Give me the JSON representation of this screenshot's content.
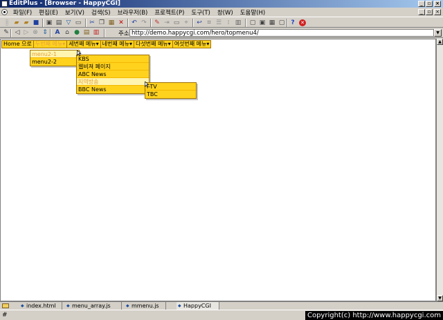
{
  "window": {
    "title": "EditPlus - [Browser - HappyCGI]"
  },
  "menubar": {
    "items": [
      "파일(F)",
      "편집(E)",
      "보기(V)",
      "검색(S)",
      "브라우저(B)",
      "프로젝트(P)",
      "도구(T)",
      "창(W)",
      "도움말(H)"
    ]
  },
  "toolbar": {
    "icons": [
      "new-file-icon",
      "open-icon",
      "save-all-icon",
      "save-icon",
      "print-preview-icon",
      "print-icon",
      "spellcheck-icon",
      "copy-file-icon",
      "cut-icon",
      "copy-icon",
      "paste-icon",
      "delete-icon",
      "undo-icon",
      "redo-icon",
      "find-icon",
      "find-next-icon",
      "replace-icon",
      "goto-icon",
      "word-wrap-icon",
      "ruler-icon",
      "line-number-icon",
      "column-icon",
      "split-icon",
      "full-screen-icon",
      "view-icon",
      "window-icon",
      "help-icon",
      "stop-icon"
    ]
  },
  "browserbar": {
    "icons": [
      "edit-pen-icon",
      "back-icon",
      "forward-icon",
      "stop-icon",
      "refresh-icon",
      "font-icon",
      "home-icon",
      "globe-icon",
      "favorites-icon",
      "history-icon"
    ],
    "address_label": "주소(A)",
    "address_value": "http://demo.happycgi.com/hero/topmenu4/"
  },
  "topmenu": {
    "items": [
      "Home 으로",
      "두번째 메뉴▾",
      "세번째 메뉴▾",
      "네번째 메뉴▾",
      "다섯번째 메뉴▾",
      "여섯번째 메뉴▾"
    ],
    "active_index": 1
  },
  "submenu_level1": {
    "items": [
      "menu2-1",
      "menu2-2"
    ],
    "highlight_index": 0
  },
  "submenu_level2": {
    "items": [
      "KBS",
      "웹비져 페이지",
      "ABC News",
      "지역방송",
      "BBC News"
    ],
    "highlight_index": 3
  },
  "submenu_level3": {
    "items": [
      "i-TV",
      "TBC"
    ]
  },
  "tabs": {
    "items": [
      "index.html",
      "menu_array.js",
      "mmenu.js",
      "HappyCGI"
    ],
    "active_index": 3
  },
  "statusbar": {
    "text": "#",
    "copyright": "Copyright(c) http://www.happycgi.com"
  },
  "colors": {
    "menu_bg": "#ffd21e",
    "menu_border": "#a07000",
    "menu_active_text": "#e9a33a",
    "titlebar": "#0a246a"
  }
}
